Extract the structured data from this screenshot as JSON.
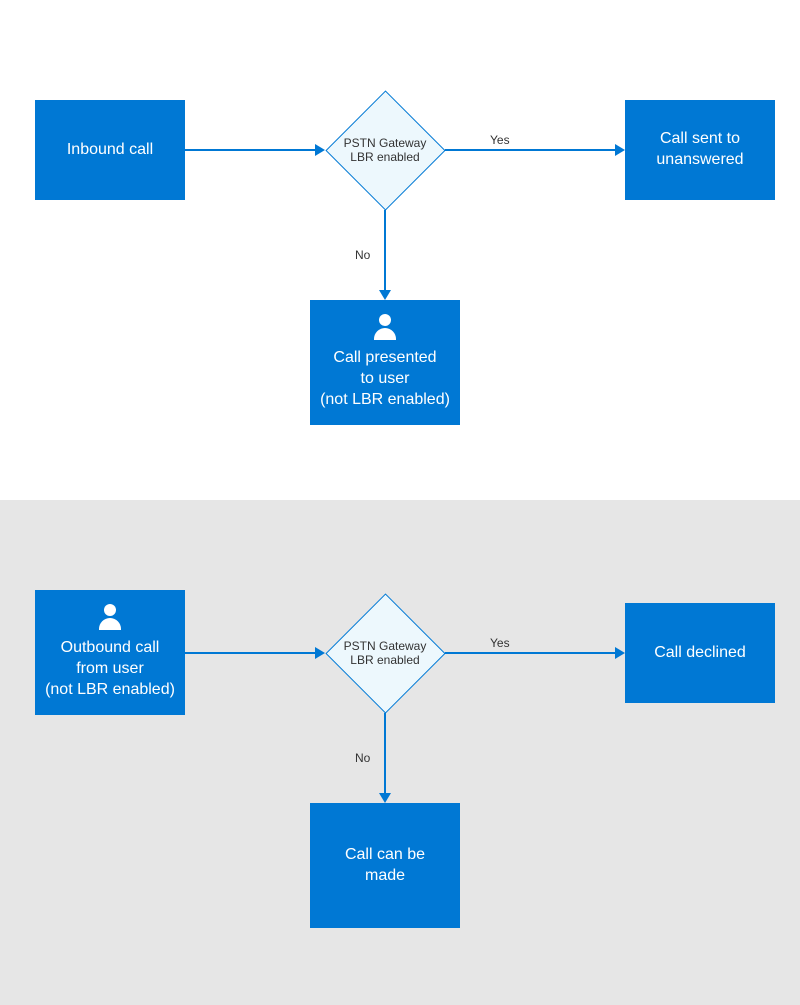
{
  "colors": {
    "primary": "#0078d4",
    "diamond_bg": "#edf8fd",
    "section_bg_bottom": "#e6e6e6"
  },
  "top": {
    "start": "Inbound call",
    "decision_line1": "PSTN Gateway",
    "decision_line2": "LBR enabled",
    "yes_label": "Yes",
    "no_label": "No",
    "yes_result_line1": "Call sent to",
    "yes_result_line2": "unanswered",
    "no_result_line1": "Call presented",
    "no_result_line2": "to user",
    "no_result_line3": "(not LBR enabled)"
  },
  "bottom": {
    "start_line1": "Outbound call",
    "start_line2": "from user",
    "start_line3": "(not LBR enabled)",
    "decision_line1": "PSTN Gateway",
    "decision_line2": "LBR enabled",
    "yes_label": "Yes",
    "no_label": "No",
    "yes_result": "Call declined",
    "no_result_line1": "Call can be",
    "no_result_line2": "made"
  }
}
